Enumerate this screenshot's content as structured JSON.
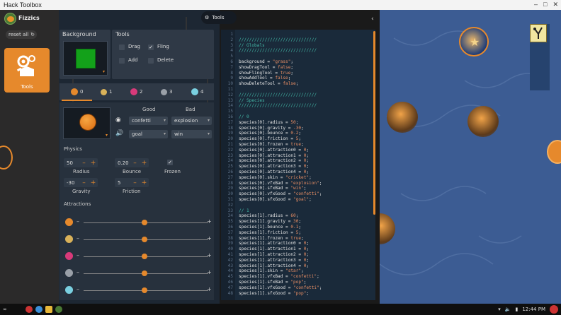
{
  "window": {
    "title": "Hack Toolbox",
    "controls": [
      "minimize",
      "maximize",
      "close"
    ]
  },
  "sidebar": {
    "app_name": "Fizzics",
    "reset_label": "reset all",
    "tools_label": "Tools"
  },
  "header": {
    "tools_label": "Tools"
  },
  "background_panel": {
    "title": "Background",
    "selected": "grass",
    "swatch_color": "#13a11a"
  },
  "tools_panel": {
    "title": "Tools",
    "items": [
      {
        "label": "Drag",
        "checked": false
      },
      {
        "label": "Fling",
        "checked": true
      },
      {
        "label": "Add",
        "checked": false
      },
      {
        "label": "Delete",
        "checked": false
      }
    ]
  },
  "species_tabs": [
    {
      "label": "0",
      "color": "#e6892c"
    },
    {
      "label": "1",
      "color": "#d9b25a"
    },
    {
      "label": "2",
      "color": "#d83a7a"
    },
    {
      "label": "3",
      "color": "#9aa0a8"
    },
    {
      "label": "4",
      "color": "#7ad0e0"
    }
  ],
  "species": {
    "good_header": "Good",
    "bad_header": "Bad",
    "vfx_good": "confetti",
    "vfx_bad": "explosion",
    "sfx_good": "goal",
    "sfx_bad": "win",
    "physics_title": "Physics",
    "radius": {
      "value": "50",
      "label": "Radius"
    },
    "bounce": {
      "value": "0.20",
      "label": "Bounce"
    },
    "frozen": {
      "label": "Frozen",
      "checked": true
    },
    "gravity": {
      "value": "-30",
      "label": "Gravity"
    },
    "friction": {
      "value": "5",
      "label": "Friction"
    },
    "attractions_title": "Attractions",
    "attractions": [
      {
        "species": "0",
        "color": "#e6892c",
        "level": 0.5
      },
      {
        "species": "1",
        "color": "#d9b25a",
        "level": 0.5
      },
      {
        "species": "2",
        "color": "#d83a7a",
        "level": 0.5
      },
      {
        "species": "3",
        "color": "#9aa0a8",
        "level": 0.5
      },
      {
        "species": "4",
        "color": "#7ad0e0",
        "level": 0.5
      }
    ],
    "minus": "–",
    "plus": "+"
  },
  "code_lines": [
    [
      {
        "t": "",
        "c": "id"
      }
    ],
    [
      {
        "t": "//////////////////////////////",
        "c": "com"
      }
    ],
    [
      {
        "t": "// Globals",
        "c": "com"
      }
    ],
    [
      {
        "t": "//////////////////////////////",
        "c": "com"
      }
    ],
    [
      {
        "t": "",
        "c": "id"
      }
    ],
    [
      {
        "t": "background = ",
        "c": "id"
      },
      {
        "t": "\"grass\"",
        "c": "str"
      },
      {
        "t": ";",
        "c": "id"
      }
    ],
    [
      {
        "t": "showDragTool = ",
        "c": "id"
      },
      {
        "t": "false",
        "c": "kw"
      },
      {
        "t": ";",
        "c": "id"
      }
    ],
    [
      {
        "t": "showFlingTool = ",
        "c": "id"
      },
      {
        "t": "true",
        "c": "kw"
      },
      {
        "t": ";",
        "c": "id"
      }
    ],
    [
      {
        "t": "showAddTool = ",
        "c": "id"
      },
      {
        "t": "false",
        "c": "kw"
      },
      {
        "t": ";",
        "c": "id"
      }
    ],
    [
      {
        "t": "showDeleteTool = ",
        "c": "id"
      },
      {
        "t": "false",
        "c": "kw"
      },
      {
        "t": ";",
        "c": "id"
      }
    ],
    [
      {
        "t": "",
        "c": "id"
      }
    ],
    [
      {
        "t": "//////////////////////////////",
        "c": "com"
      }
    ],
    [
      {
        "t": "// Species",
        "c": "com"
      }
    ],
    [
      {
        "t": "//////////////////////////////",
        "c": "com"
      }
    ],
    [
      {
        "t": "",
        "c": "id"
      }
    ],
    [
      {
        "t": "// 0",
        "c": "com"
      }
    ],
    [
      {
        "t": "species[0].radius = ",
        "c": "id"
      },
      {
        "t": "50",
        "c": "num"
      },
      {
        "t": ";",
        "c": "id"
      }
    ],
    [
      {
        "t": "species[0].gravity = ",
        "c": "id"
      },
      {
        "t": "-30",
        "c": "num"
      },
      {
        "t": ";",
        "c": "id"
      }
    ],
    [
      {
        "t": "species[0].bounce = ",
        "c": "id"
      },
      {
        "t": "0.2",
        "c": "num"
      },
      {
        "t": ";",
        "c": "id"
      }
    ],
    [
      {
        "t": "species[0].friction = ",
        "c": "id"
      },
      {
        "t": "5",
        "c": "num"
      },
      {
        "t": ";",
        "c": "id"
      }
    ],
    [
      {
        "t": "species[0].frozen = ",
        "c": "id"
      },
      {
        "t": "true",
        "c": "kw"
      },
      {
        "t": ";",
        "c": "id"
      }
    ],
    [
      {
        "t": "species[0].attraction0 = ",
        "c": "id"
      },
      {
        "t": "0",
        "c": "num"
      },
      {
        "t": ";",
        "c": "id"
      }
    ],
    [
      {
        "t": "species[0].attraction1 = ",
        "c": "id"
      },
      {
        "t": "0",
        "c": "num"
      },
      {
        "t": ";",
        "c": "id"
      }
    ],
    [
      {
        "t": "species[0].attraction2 = ",
        "c": "id"
      },
      {
        "t": "0",
        "c": "num"
      },
      {
        "t": ";",
        "c": "id"
      }
    ],
    [
      {
        "t": "species[0].attraction3 = ",
        "c": "id"
      },
      {
        "t": "0",
        "c": "num"
      },
      {
        "t": ";",
        "c": "id"
      }
    ],
    [
      {
        "t": "species[0].attraction4 = ",
        "c": "id"
      },
      {
        "t": "0",
        "c": "num"
      },
      {
        "t": ";",
        "c": "id"
      }
    ],
    [
      {
        "t": "species[0].skin = ",
        "c": "id"
      },
      {
        "t": "\"cricket\"",
        "c": "str"
      },
      {
        "t": ";",
        "c": "id"
      }
    ],
    [
      {
        "t": "species[0].vfxBad = ",
        "c": "id"
      },
      {
        "t": "\"explosion\"",
        "c": "str"
      },
      {
        "t": ";",
        "c": "id"
      }
    ],
    [
      {
        "t": "species[0].sfxBad = ",
        "c": "id"
      },
      {
        "t": "\"win\"",
        "c": "str"
      },
      {
        "t": ";",
        "c": "id"
      }
    ],
    [
      {
        "t": "species[0].vfxGood = ",
        "c": "id"
      },
      {
        "t": "\"confetti\"",
        "c": "str"
      },
      {
        "t": ";",
        "c": "id"
      }
    ],
    [
      {
        "t": "species[0].sfxGood = ",
        "c": "id"
      },
      {
        "t": "\"goal\"",
        "c": "str"
      },
      {
        "t": ";",
        "c": "id"
      }
    ],
    [
      {
        "t": "",
        "c": "id"
      }
    ],
    [
      {
        "t": "// 1",
        "c": "com"
      }
    ],
    [
      {
        "t": "species[1].radius = ",
        "c": "id"
      },
      {
        "t": "60",
        "c": "num"
      },
      {
        "t": ";",
        "c": "id"
      }
    ],
    [
      {
        "t": "species[1].gravity = ",
        "c": "id"
      },
      {
        "t": "30",
        "c": "num"
      },
      {
        "t": ";",
        "c": "id"
      }
    ],
    [
      {
        "t": "species[1].bounce = ",
        "c": "id"
      },
      {
        "t": "0.1",
        "c": "num"
      },
      {
        "t": ";",
        "c": "id"
      }
    ],
    [
      {
        "t": "species[1].friction = ",
        "c": "id"
      },
      {
        "t": "5",
        "c": "num"
      },
      {
        "t": ";",
        "c": "id"
      }
    ],
    [
      {
        "t": "species[1].frozen = ",
        "c": "id"
      },
      {
        "t": "true",
        "c": "kw"
      },
      {
        "t": ";",
        "c": "id"
      }
    ],
    [
      {
        "t": "species[1].attraction0 = ",
        "c": "id"
      },
      {
        "t": "0",
        "c": "num"
      },
      {
        "t": ";",
        "c": "id"
      }
    ],
    [
      {
        "t": "species[1].attraction1 = ",
        "c": "id"
      },
      {
        "t": "0",
        "c": "num"
      },
      {
        "t": ";",
        "c": "id"
      }
    ],
    [
      {
        "t": "species[1].attraction2 = ",
        "c": "id"
      },
      {
        "t": "0",
        "c": "num"
      },
      {
        "t": ";",
        "c": "id"
      }
    ],
    [
      {
        "t": "species[1].attraction3 = ",
        "c": "id"
      },
      {
        "t": "0",
        "c": "num"
      },
      {
        "t": ";",
        "c": "id"
      }
    ],
    [
      {
        "t": "species[1].attraction4 = ",
        "c": "id"
      },
      {
        "t": "0",
        "c": "num"
      },
      {
        "t": ";",
        "c": "id"
      }
    ],
    [
      {
        "t": "species[1].skin = ",
        "c": "id"
      },
      {
        "t": "\"star\"",
        "c": "str"
      },
      {
        "t": ";",
        "c": "id"
      }
    ],
    [
      {
        "t": "species[1].vfxBad = ",
        "c": "id"
      },
      {
        "t": "\"confetti\"",
        "c": "str"
      },
      {
        "t": ";",
        "c": "id"
      }
    ],
    [
      {
        "t": "species[1].sfxBad = ",
        "c": "id"
      },
      {
        "t": "\"pop\"",
        "c": "str"
      },
      {
        "t": ";",
        "c": "id"
      }
    ],
    [
      {
        "t": "species[1].vfxGood = ",
        "c": "id"
      },
      {
        "t": "\"confetti\"",
        "c": "str"
      },
      {
        "t": ";",
        "c": "id"
      }
    ],
    [
      {
        "t": "species[1].sfxGood = ",
        "c": "id"
      },
      {
        "t": "\"pop\"",
        "c": "str"
      },
      {
        "t": ";",
        "c": "id"
      }
    ]
  ],
  "taskbar": {
    "time": "12:44 PM",
    "apps": [
      "chrome-icon",
      "files-icon",
      "app-icon"
    ]
  },
  "colors": {
    "accent": "#e6892c",
    "panel": "#2f3946",
    "editor": "#1a2a3a",
    "canvas": "#3c5c93"
  }
}
